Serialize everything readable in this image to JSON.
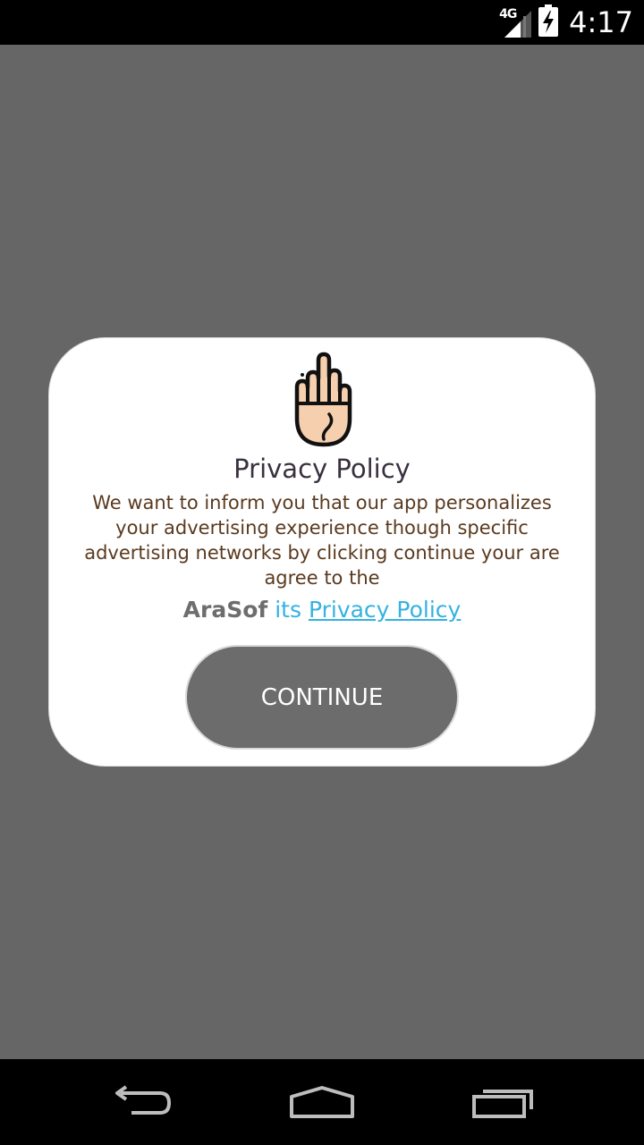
{
  "status_bar": {
    "network_type": "4G",
    "time": "4:17",
    "icons": [
      "signal-icon",
      "battery-charging-icon"
    ]
  },
  "dialog": {
    "icon": "raised-hand-icon",
    "title": "Privacy Policy",
    "message": "We want to inform you that our app personalizes your advertising experience though specific advertising networks by clicking continue your are agree to the",
    "brand": "AraSof",
    "its": "its",
    "policy_link": "Privacy Policy",
    "continue_label": "CONTINUE"
  },
  "nav_bar": {
    "icons": [
      "back-icon",
      "home-icon",
      "recents-icon"
    ]
  },
  "colors": {
    "overlay": "#666666",
    "dialog_bg": "#ffffff",
    "button_bg": "#6c6c6c",
    "link": "#35b2e0",
    "message_text": "#5a3a1e",
    "brand_text": "#6d6d6d"
  }
}
